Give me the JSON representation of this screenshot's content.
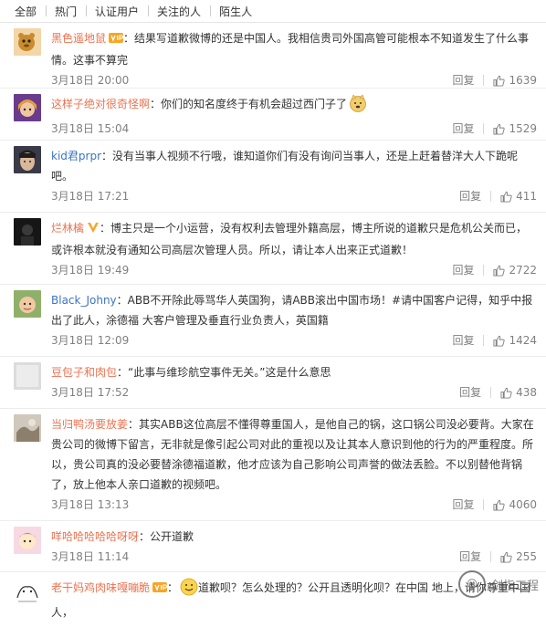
{
  "tabs": [
    "全部",
    "热门",
    "认证用户",
    "关注的人",
    "陌生人"
  ],
  "reply_label": "回复",
  "comments": [
    {
      "user": "黑色遥地鼠",
      "text": "：结果写道歉微博的还是中国人。我相信贵司外国高管可能根本不知道发生了什么事情。这事不算完",
      "time": "3月18日 20:00",
      "likes": "1639"
    },
    {
      "user": "这样子绝对很奇怪啊",
      "text": "：你们的知名度终于有机会超过西门子了",
      "time": "3月18日 15:04",
      "likes": "1529"
    },
    {
      "user": "kid君prpr",
      "text": "：没有当事人视频不行哦，谁知道你们有没有询问当事人，还是上赶着替洋大人下跪呢吧。",
      "time": "3月18日 17:21",
      "likes": "411"
    },
    {
      "user": "烂林檎",
      "text": "：博主只是一个小运营，没有权利去管理外籍高层，博主所说的道歉只是危机公关而已，或许根本就没有通知公司高层次管理人员。所以，请让本人出来正式道歉！",
      "time": "3月18日 19:49",
      "likes": "2722"
    },
    {
      "user": "Black_Johny",
      "text": "：ABB不开除此辱骂华人英国狗，请ABB滚出中国市场！#请中国客户记得，知乎中报出了此人，涂德福 大客户管理及垂直行业负责人，英国籍",
      "time": "3月18日 12:09",
      "likes": "1424"
    },
    {
      "user": "豆包子和肉包",
      "text": "：“此事与维珍航空事件无关。”这是什么意思",
      "time": "3月18日 17:52",
      "likes": "438"
    },
    {
      "user": "当归鸭汤要放姜",
      "text": "：其实ABB这位高层不懂得尊重国人，是他自己的锅，这口锅公司没必要背。大家在贵公司的微博下留言，无非就是像引起公司对此的重视以及让其本人意识到他的行为的严重程度。所以，贵公司真的没必要替涂德福道歉，他才应该为自己影响公司声誉的做法丢脸。不以别替他背锅了，放上他本人亲口道歉的视频吧。",
      "time": "3月18日 13:13",
      "likes": "4060"
    },
    {
      "user": "咩哈哈哈哈哈呀呀",
      "text": "：公开道歉",
      "time": "3月18日 11:14",
      "likes": "255"
    },
    {
      "user": "老干妈鸡肉味嘎嘣脆",
      "text": "道歉呗？怎么处理的？公开且透明化呗？在中国",
      "text2": "地上，请你尊重中国人，",
      "time": "",
      "likes": ""
    }
  ],
  "watermark": "剑指工程",
  "colors": {
    "username": "#eb7350",
    "meta": "#808080",
    "accent_blue": "#3c74c2"
  }
}
